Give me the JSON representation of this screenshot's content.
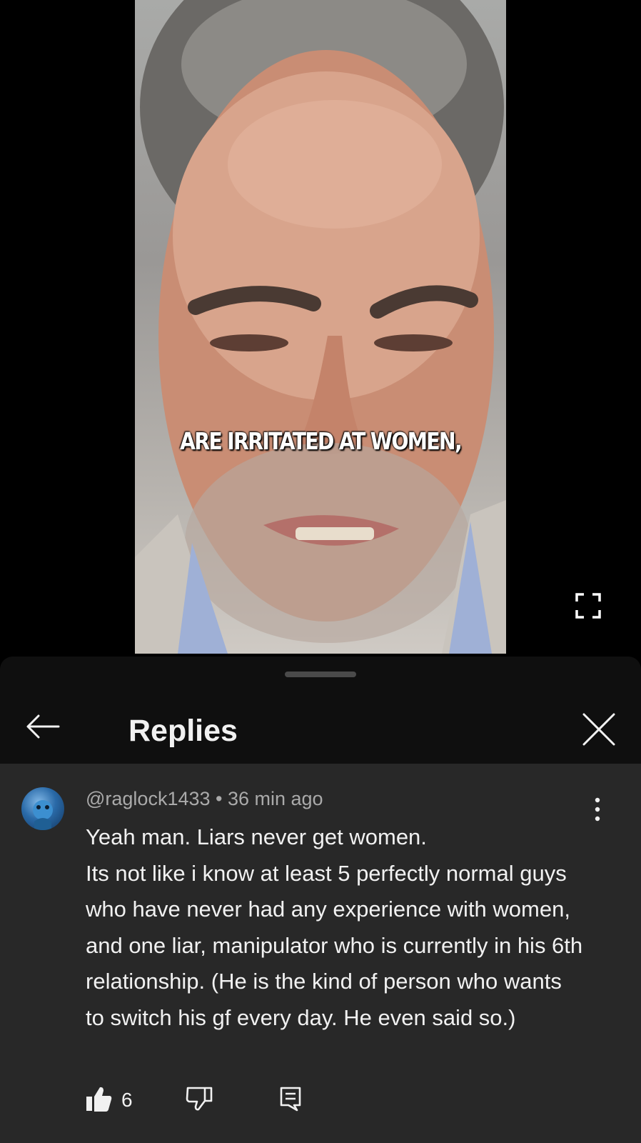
{
  "video": {
    "caption": "ARE IRRITATED AT WOMEN,",
    "progress_fraction": 0.035
  },
  "sheet": {
    "title": "Replies",
    "icons": {
      "back": "arrow-left-icon",
      "close": "close-icon",
      "fullscreen": "fullscreen-icon"
    }
  },
  "comment": {
    "author": "@raglock1433",
    "separator": " • ",
    "time": "36 min ago",
    "lines": [
      "Yeah man. Liars never get women.",
      "Its not like i know at least 5 perfectly normal guys who have never had any experience with women, and one liar, manipulator who is currently in his 6th relationship. (He is the kind of person who wants to switch his gf every day. He even said so.)"
    ],
    "likes": "6",
    "icons": {
      "more": "more-vert-icon",
      "like": "thumb-up-icon",
      "dislike": "thumb-down-icon",
      "reply": "comment-reply-icon"
    }
  },
  "colors": {
    "sheet_bg": "#0f0f0f",
    "comment_bg": "#282828",
    "meta_text": "#aaaaaa",
    "text": "#f1f1f1"
  }
}
